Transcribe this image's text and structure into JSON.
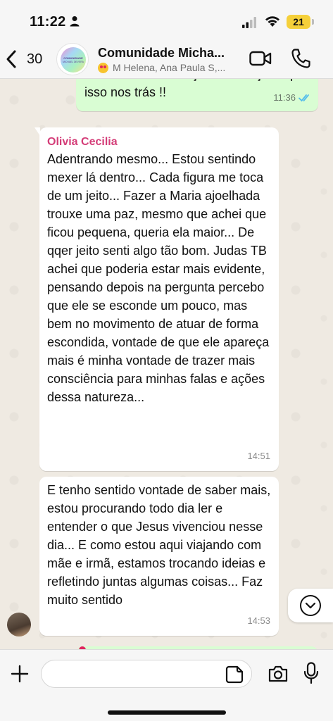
{
  "status_bar": {
    "time": "11:22",
    "battery_level": "21"
  },
  "header": {
    "back_count": "30",
    "title": "Comunidade Micha...",
    "subtitle": "M Helena, Ana Paula S,...",
    "avatar_text_line1": "COMUNIDADE",
    "avatar_text_line2": "MICHAEL DEVERA"
  },
  "messages": {
    "outgoing_partial": {
      "text": "sentimentos e emoções sensações que isso nos trás !!",
      "time": "11:36"
    },
    "incoming_1": {
      "sender": "Olivia Cecilia",
      "text": "Adentrando mesmo... Estou sentindo mexer lá dentro... Cada figura me toca de um jeito... Fazer a Maria ajoelhada trouxe uma paz, mesmo que achei que ficou pequena, queria ela maior... De qqer jeito senti algo tão bom. Judas TB achei que poderia estar mais evidente, pensando depois na pergunta percebo que ele se esconde um pouco, mas bem no movimento de atuar de forma escondida, vontade de que ele apareça mais é minha vontade de trazer mais consciência para minhas falas e ações dessa natureza...",
      "time": "14:51"
    },
    "incoming_2": {
      "text": "E tenho sentido vontade de saber mais, estou procurando todo dia ler e entender o que Jesus vivenciou nesse dia... E como estou aqui viajando com mãe e irmã, estamos trocando ideias e refletindo juntas algumas coisas... Faz muito sentido",
      "time": "14:53"
    }
  },
  "input_bar": {
    "value": "",
    "placeholder": ""
  },
  "icons": {
    "back": "chevron-left-icon",
    "video": "video-camera-icon",
    "call": "phone-icon",
    "attach": "plus-icon",
    "sticker": "sticker-icon",
    "camera": "camera-icon",
    "mic": "microphone-icon",
    "scroll": "chevron-down-icon"
  },
  "colors": {
    "outgoing_bubble": "#d9fdd3",
    "incoming_bubble": "#ffffff",
    "sender_name": "#d43d78",
    "read_ticks": "#53bdeb",
    "chat_background": "#efeae2"
  }
}
